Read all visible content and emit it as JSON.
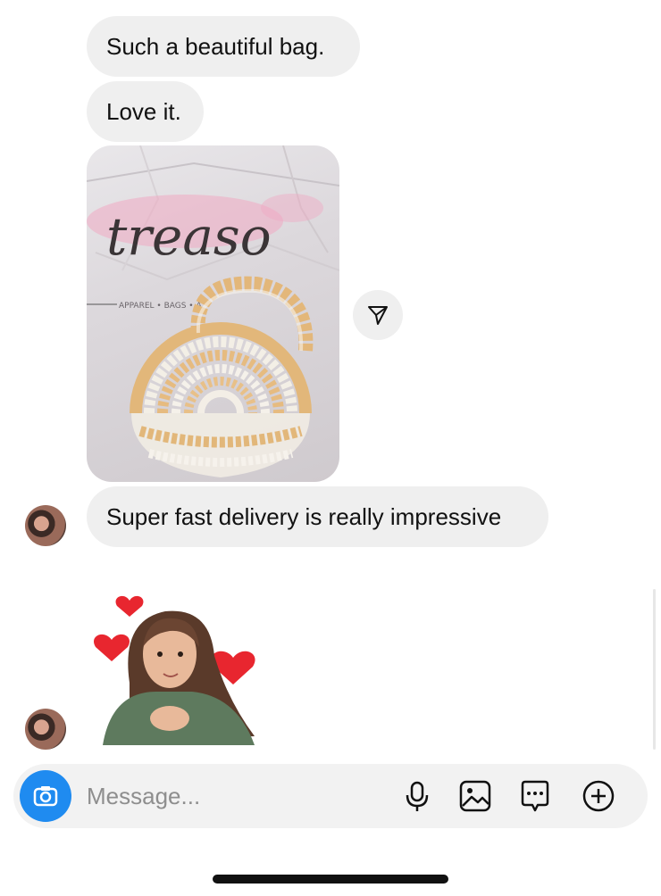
{
  "messages": [
    {
      "text": "Such a beautiful bag."
    },
    {
      "text": "Love it."
    },
    {
      "text": "Super fast delivery is really impressive"
    }
  ],
  "photo": {
    "brand": "treaso",
    "tagline": "APPAREL • BAGS • A",
    "icon": "shared-photo-of-pearl-handbag"
  },
  "share": {
    "icon": "send-icon"
  },
  "sticker": {
    "icon": "avatar-sticker-with-hearts"
  },
  "composer": {
    "placeholder": "Message...",
    "camera_icon": "camera-icon",
    "mic_icon": "microphone-icon",
    "gallery_icon": "gallery-icon",
    "sticker_icon": "sticker-icon",
    "add_icon": "add-icon"
  },
  "colors": {
    "bubble": "#efefef",
    "camera": "#1f8bf0",
    "composer": "#f2f2f2",
    "brand_text": "#3a3436",
    "brand_wash": "#f0a9c3"
  }
}
